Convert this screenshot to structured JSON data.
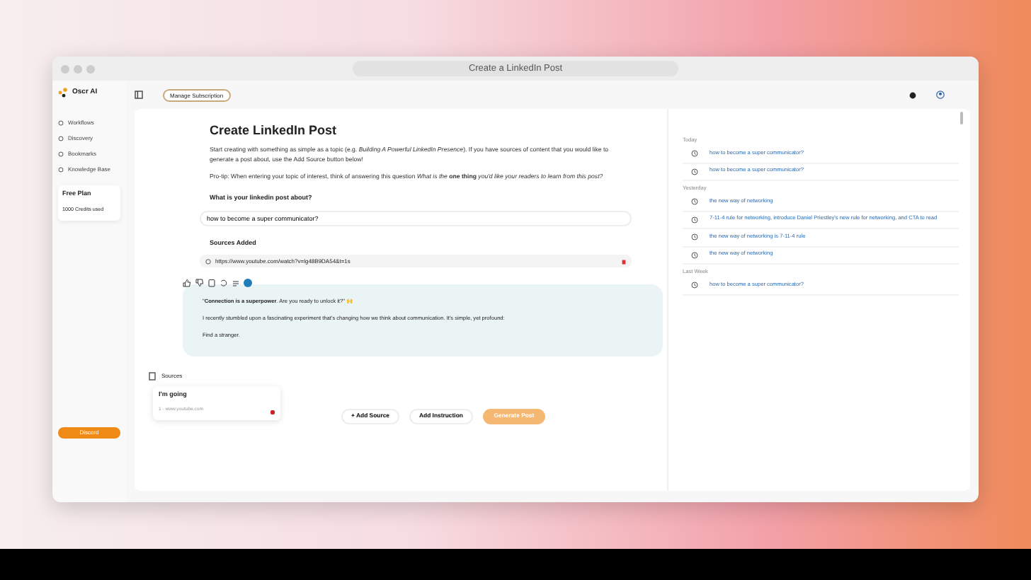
{
  "window": {
    "title": "Create a LinkedIn Post"
  },
  "sidebar": {
    "brand": "Oscr AI",
    "items": [
      {
        "label": "Workflows"
      },
      {
        "label": "Discovery"
      },
      {
        "label": "Bookmarks"
      },
      {
        "label": "Knowledge Base"
      }
    ],
    "plan": {
      "title": "Free Plan",
      "credits": "1000 Credits used"
    },
    "discord": "Discord"
  },
  "topbar": {
    "manage_subscription": "Manage Subscription"
  },
  "main": {
    "title": "Create LinkedIn Post",
    "intro": "Start creating with something as simple as a topic (e.g. *Building A Powerful LinkedIn Presence*). If you have sources of content that you would like to generate a post about, use the Add Source button below!",
    "protip": "Pro-tip: When entering your topic of interest, think of answering this question *What is the* **one thing** *you'd like your readers to learn from this post?*",
    "question": "What is your linkedin post about?",
    "topic_value": "how to become a super communicator?",
    "sources_added": "Sources Added",
    "source_url": "https://www.youtube.com/watch?v=lg48B9DA54&t=1s",
    "post": [
      {
        "text": "\"**Connection is a superpower**. Are you ready to unlock it?\" 🙌"
      },
      {
        "text": "I recently stumbled upon a fascinating experiment that's changing how we think about communication. It's simple, yet profound:"
      },
      {
        "text": "Find a stranger."
      }
    ],
    "sources_heading": "Sources",
    "sources": [
      {
        "title": "I'm going",
        "url": "1 - www.youtube.com"
      }
    ],
    "buttons": [
      {
        "label": "+ Add Source",
        "kind": "outline",
        "disabled": false
      },
      {
        "label": "Add Instruction",
        "kind": "outline",
        "disabled": false
      },
      {
        "label": "Generate Post",
        "kind": "primary",
        "disabled": true
      }
    ]
  },
  "history": [
    {
      "label": "Today",
      "items": [
        {
          "text": "how to become a super communicator?"
        },
        {
          "text": "how to become a super communicator?"
        }
      ]
    },
    {
      "label": "Yesterday",
      "items": [
        {
          "text": "the new way of networking"
        },
        {
          "text": "7-11-4 rule for networking, introduce Daniel Priestley's new rule for networking, and CTA to read"
        },
        {
          "text": "the new way of networking is 7-11-4 rule"
        },
        {
          "text": "the new way of networking"
        }
      ]
    },
    {
      "label": "Last Week",
      "items": [
        {
          "text": "how to become a super communicator?"
        }
      ]
    }
  ]
}
